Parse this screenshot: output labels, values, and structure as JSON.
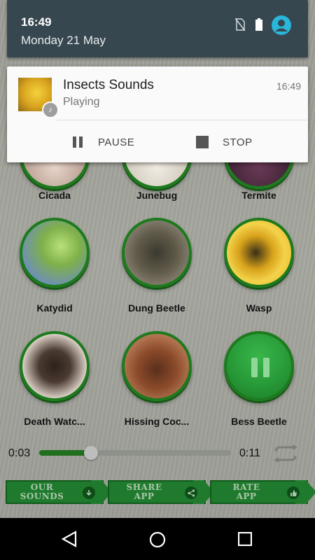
{
  "status": {
    "time": "16:49",
    "date": "Monday 21 May"
  },
  "notification": {
    "title": "Insects Sounds",
    "subtitle": "Playing",
    "time": "16:49",
    "actions": [
      {
        "label": "PAUSE",
        "icon": "pause-icon"
      },
      {
        "label": "STOP",
        "icon": "stop-icon"
      }
    ]
  },
  "insects": {
    "row1": [
      "Cicada",
      "Junebug",
      "Termite"
    ],
    "row2": [
      "Katydid",
      "Dung Beetle",
      "Wasp"
    ],
    "row3": [
      "Death Watc...",
      "Hissing Coc...",
      "Bess Beetle"
    ]
  },
  "player": {
    "current": "0:03",
    "total": "0:11",
    "progress": 0.27
  },
  "bottom_buttons": [
    {
      "line1": "OUR",
      "line2": "SOUNDS",
      "icon": "download-icon"
    },
    {
      "line1": "SHARE",
      "line2": "APP",
      "icon": "share-icon"
    },
    {
      "line1": "RATE",
      "line2": "APP",
      "icon": "thumbs-up-icon"
    }
  ],
  "colors": {
    "accent_green": "#1f7a2e",
    "shade": "#37474f",
    "user_icon": "#29b6d8"
  }
}
